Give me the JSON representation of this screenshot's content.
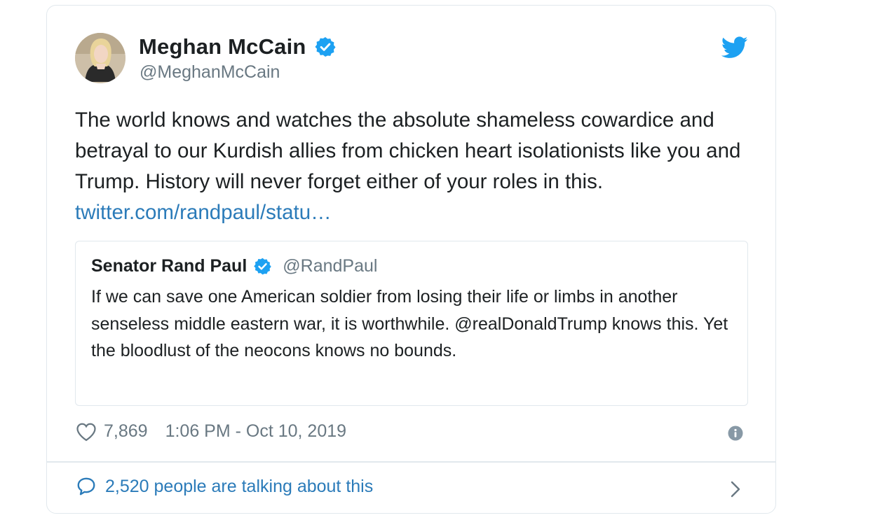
{
  "author": {
    "name": "Meghan McCain",
    "handle": "@MeghanMcCain",
    "verified": true
  },
  "tweet": {
    "text": "The world knows and watches the absolute shameless cowardice and betrayal to our Kurdish allies from chicken heart isolationists like you and Trump. History will never forget either of your roles in this. ",
    "link": "twitter.com/randpaul/statu…"
  },
  "quoted_tweet": {
    "name": "Senator Rand Paul",
    "handle": "@RandPaul",
    "verified": true,
    "text": "If we can save one American soldier from losing their life or limbs in another senseless middle eastern war, it is worthwhile. @realDonaldTrump knows this. Yet the bloodlust of the neocons knows no bounds."
  },
  "footer": {
    "likes": "7,869",
    "timestamp": "1:06 PM - Oct 10, 2019",
    "conversation": "2,520 people are talking about this"
  },
  "icons": [
    "verified-badge-icon",
    "twitter-bird-icon",
    "heart-icon",
    "info-icon",
    "speech-bubble-icon",
    "chevron-right-icon"
  ],
  "colors": {
    "twitter_blue": "#1da1f2",
    "link_blue": "#2b7bb9",
    "secondary_text": "#697882",
    "border": "#e1e8ed"
  }
}
